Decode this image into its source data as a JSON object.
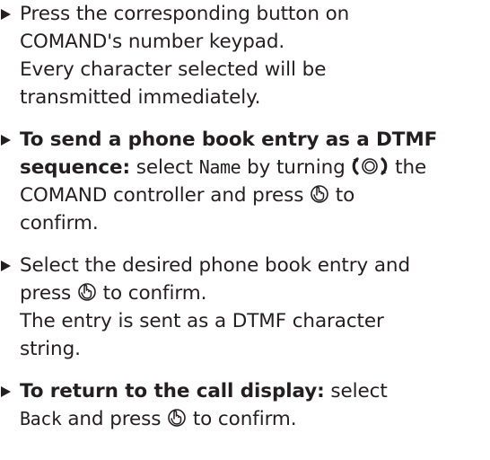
{
  "steps": [
    {
      "lines": [
        [
          "Press the corresponding button on"
        ],
        [
          "COMAND's number keypad."
        ],
        [
          "Every character selected will be"
        ],
        [
          "transmitted immediately."
        ]
      ]
    },
    {
      "bold_lead_1": "To send a phone book entry as a DTMF",
      "bold_lead_2": "sequence:",
      "text_select": "select",
      "ui_name": "Name",
      "text_by_turning": "by turning",
      "text_the": "the",
      "text_controller": "COMAND controller and press",
      "text_to": "to",
      "text_confirm": "confirm."
    },
    {
      "text_1": "Select the desired phone book entry and",
      "text_press": "press",
      "text_to_confirm": "to confirm.",
      "text_3": "The entry is sent as a DTMF character",
      "text_4": "string."
    },
    {
      "bold_lead": "To return to the call display:",
      "text_select": "select",
      "ui_back": "Back",
      "text_press_confirm_a": "and press",
      "text_press_confirm_b": "to confirm."
    }
  ],
  "icons": {
    "turn": "rotate-controller-icon",
    "press": "press-controller-icon"
  },
  "colors": {
    "text": "#231f20",
    "background": "#ffffff"
  }
}
